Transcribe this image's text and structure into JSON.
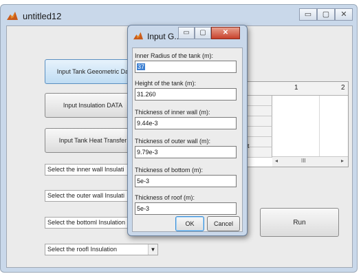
{
  "window": {
    "title": "untitled12",
    "minimize_label": "▭",
    "maximize_label": "▢",
    "close_label": "✕"
  },
  "main": {
    "buttons": {
      "geometric": "Input Tank Geeometric Da",
      "insulation": "Input Insulation DATA",
      "heat_transfer": "Input Tank Heat Transfer"
    },
    "selects": {
      "inner": "Select the inner wall Insulati",
      "outer": "Select the outer wall Insulati",
      "bottom": "Select the bottoml Insulation",
      "roof": "Select the roofl Insulation"
    },
    "table": {
      "columns": [
        "1",
        "2"
      ],
      "scroll_thumb": "III"
    },
    "run_label": "Run",
    "partial_text": "t"
  },
  "dialog": {
    "title": "Input G...",
    "minimize_label": "▭",
    "maximize_label": "▢",
    "close_label": "✕",
    "fields": [
      {
        "label": "Inner Radius of the tank (m):",
        "value": "37"
      },
      {
        "label": "Height of the tank (m):",
        "value": "31.260"
      },
      {
        "label": "Thickness of inner wall (m):",
        "value": "9.44e-3"
      },
      {
        "label": "Thickness of outer wall (m):",
        "value": "9.79e-3"
      },
      {
        "label": "Thickness of bottom (m):",
        "value": "5e-3"
      },
      {
        "label": "Thickness of roof (m):",
        "value": "5e-3"
      }
    ],
    "ok_label": "OK",
    "cancel_label": "Cancel"
  },
  "colors": {
    "accent": "#3c7fd1",
    "frame": "#c9d8ea",
    "close": "#c8412c"
  }
}
